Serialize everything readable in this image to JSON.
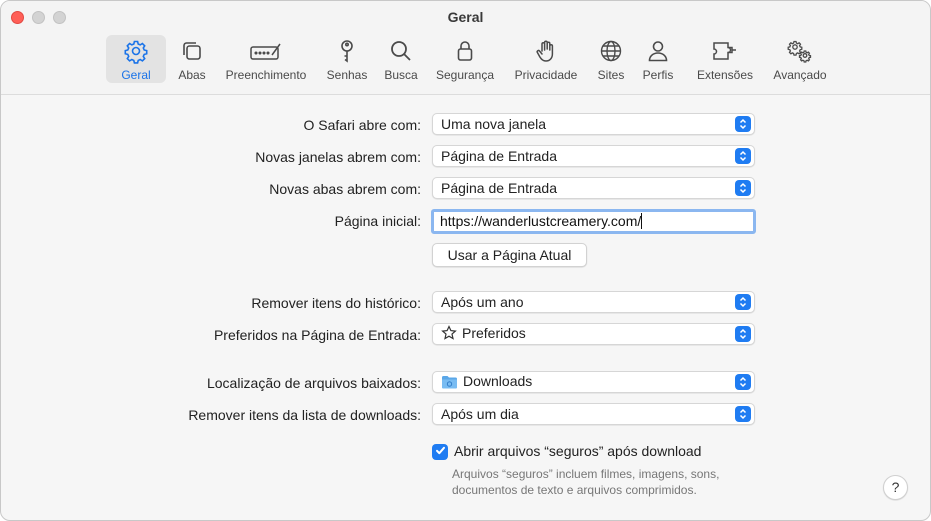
{
  "window": {
    "title": "Geral"
  },
  "toolbar": {
    "items": [
      {
        "label": "Geral",
        "icon": "gear-icon",
        "active": true
      },
      {
        "label": "Abas",
        "icon": "tabs-icon"
      },
      {
        "label": "Preenchimento",
        "icon": "autofill-icon"
      },
      {
        "label": "Senhas",
        "icon": "key-icon"
      },
      {
        "label": "Busca",
        "icon": "search-icon"
      },
      {
        "label": "Segurança",
        "icon": "lock-icon"
      },
      {
        "label": "Privacidade",
        "icon": "hand-icon"
      },
      {
        "label": "Sites",
        "icon": "globe-icon"
      },
      {
        "label": "Perfis",
        "icon": "person-icon"
      },
      {
        "label": "Extensões",
        "icon": "puzzle-icon"
      },
      {
        "label": "Avançado",
        "icon": "gears-icon"
      }
    ],
    "accent_color": "#1a73e8"
  },
  "settings": {
    "safari_opens_with": {
      "label": "O Safari abre com:",
      "value": "Uma nova janela"
    },
    "new_windows_open_with": {
      "label": "Novas janelas abrem com:",
      "value": "Página de Entrada"
    },
    "new_tabs_open_with": {
      "label": "Novas abas abrem com:",
      "value": "Página de Entrada"
    },
    "homepage": {
      "label": "Página inicial:",
      "value": "https://wanderlustcreamery.com/"
    },
    "use_current_page_button": "Usar a Página Atual",
    "remove_history": {
      "label": "Remover itens do histórico:",
      "value": "Após um ano"
    },
    "favorites_start_page": {
      "label": "Preferidos na Página de Entrada:",
      "value": "Preferidos",
      "icon": "star-icon"
    },
    "download_location": {
      "label": "Localização de arquivos baixados:",
      "value": "Downloads",
      "icon": "folder-icon"
    },
    "remove_download_list": {
      "label": "Remover itens da lista de downloads:",
      "value": "Após um dia"
    },
    "open_safe_files": {
      "label": "Abrir arquivos “seguros” após download",
      "checked": true,
      "note": "Arquivos “seguros” incluem filmes, imagens, sons, documentos de texto e arquivos comprimidos."
    },
    "help_button": "?"
  }
}
